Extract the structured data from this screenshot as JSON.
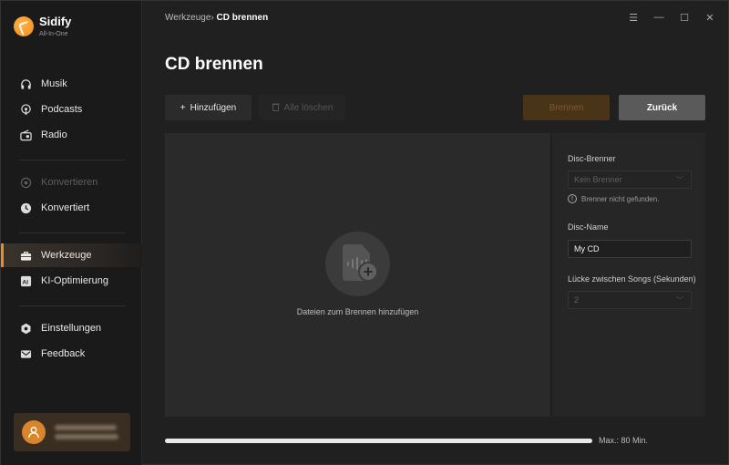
{
  "app": {
    "name": "Sidify",
    "subtitle": "All-In-One"
  },
  "sidebar": {
    "items": [
      {
        "label": "Musik",
        "icon": "headphones-icon"
      },
      {
        "label": "Podcasts",
        "icon": "podcast-icon"
      },
      {
        "label": "Radio",
        "icon": "radio-icon"
      },
      {
        "label": "Konvertieren",
        "icon": "convert-icon",
        "disabled": true
      },
      {
        "label": "Konvertiert",
        "icon": "clock-icon"
      },
      {
        "label": "Werkzeuge",
        "icon": "toolbox-icon",
        "active": true
      },
      {
        "label": "KI-Optimierung",
        "icon": "ai-icon"
      },
      {
        "label": "Einstellungen",
        "icon": "gear-icon"
      },
      {
        "label": "Feedback",
        "icon": "mail-icon"
      }
    ]
  },
  "breadcrumb": {
    "parent": "Werkzeuge",
    "separator": "›",
    "current": "CD brennen"
  },
  "page": {
    "title": "CD brennen"
  },
  "toolbar": {
    "add_label": "Hinzufügen",
    "clear_label": "Alle löschen",
    "burn_label": "Brennen",
    "back_label": "Zurück"
  },
  "drop_area": {
    "hint": "Dateien zum Brennen hinzufügen"
  },
  "settings": {
    "burner_label": "Disc-Brenner",
    "burner_value": "Kein Brenner",
    "burner_warning": "Brenner nicht gefunden.",
    "disc_name_label": "Disc-Name",
    "disc_name_value": "My CD",
    "gap_label": "Lücke zwischen Songs (Sekunden)",
    "gap_value": "2"
  },
  "capacity": {
    "label": "Max.: 80 Min.",
    "fill_percent": 100
  },
  "colors": {
    "accent": "#f08a1c",
    "background": "#202020",
    "sidebar": "#1a1a1a"
  }
}
